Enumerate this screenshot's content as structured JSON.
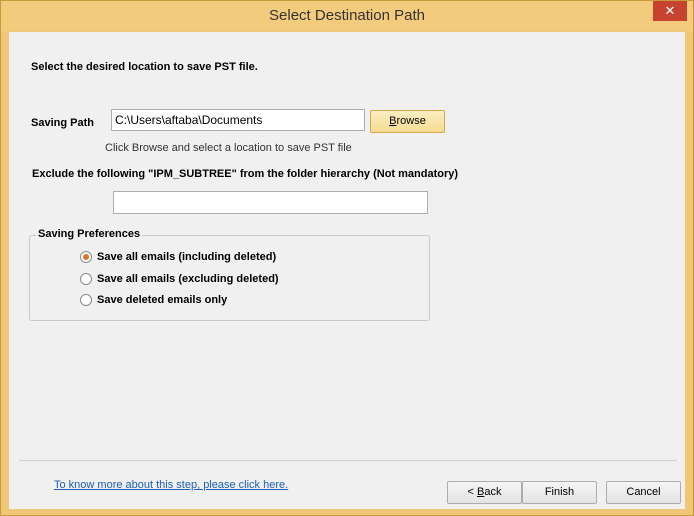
{
  "window": {
    "title": "Select Destination Path",
    "close_glyph": "✕"
  },
  "heading": "Select the desired location to save PST file.",
  "saving_path": {
    "label": "Saving Path",
    "value": "C:\\Users\\aftaba\\Documents",
    "browse_label_underlined": "B",
    "browse_label_rest": "rowse",
    "hint": "Click Browse and select a location to save PST file"
  },
  "exclude": {
    "label": "Exclude the following \"IPM_SUBTREE\" from the folder hierarchy (Not mandatory)",
    "value": ""
  },
  "preferences": {
    "title": "Saving Preferences",
    "options": [
      {
        "label": "Save all emails (including deleted)",
        "checked": true
      },
      {
        "label": "Save all emails (excluding deleted)",
        "checked": false
      },
      {
        "label": "Save deleted emails only",
        "checked": false
      }
    ]
  },
  "footer": {
    "help_link": "To know more about this step, please click here.",
    "back_prefix": "< ",
    "back_underlined": "B",
    "back_rest": "ack",
    "finish_label": "Finish",
    "cancel_label": "Cancel"
  },
  "colors": {
    "accent": "#f0c776",
    "radio_selected": "#e0722a",
    "link": "#1a5fb4"
  }
}
